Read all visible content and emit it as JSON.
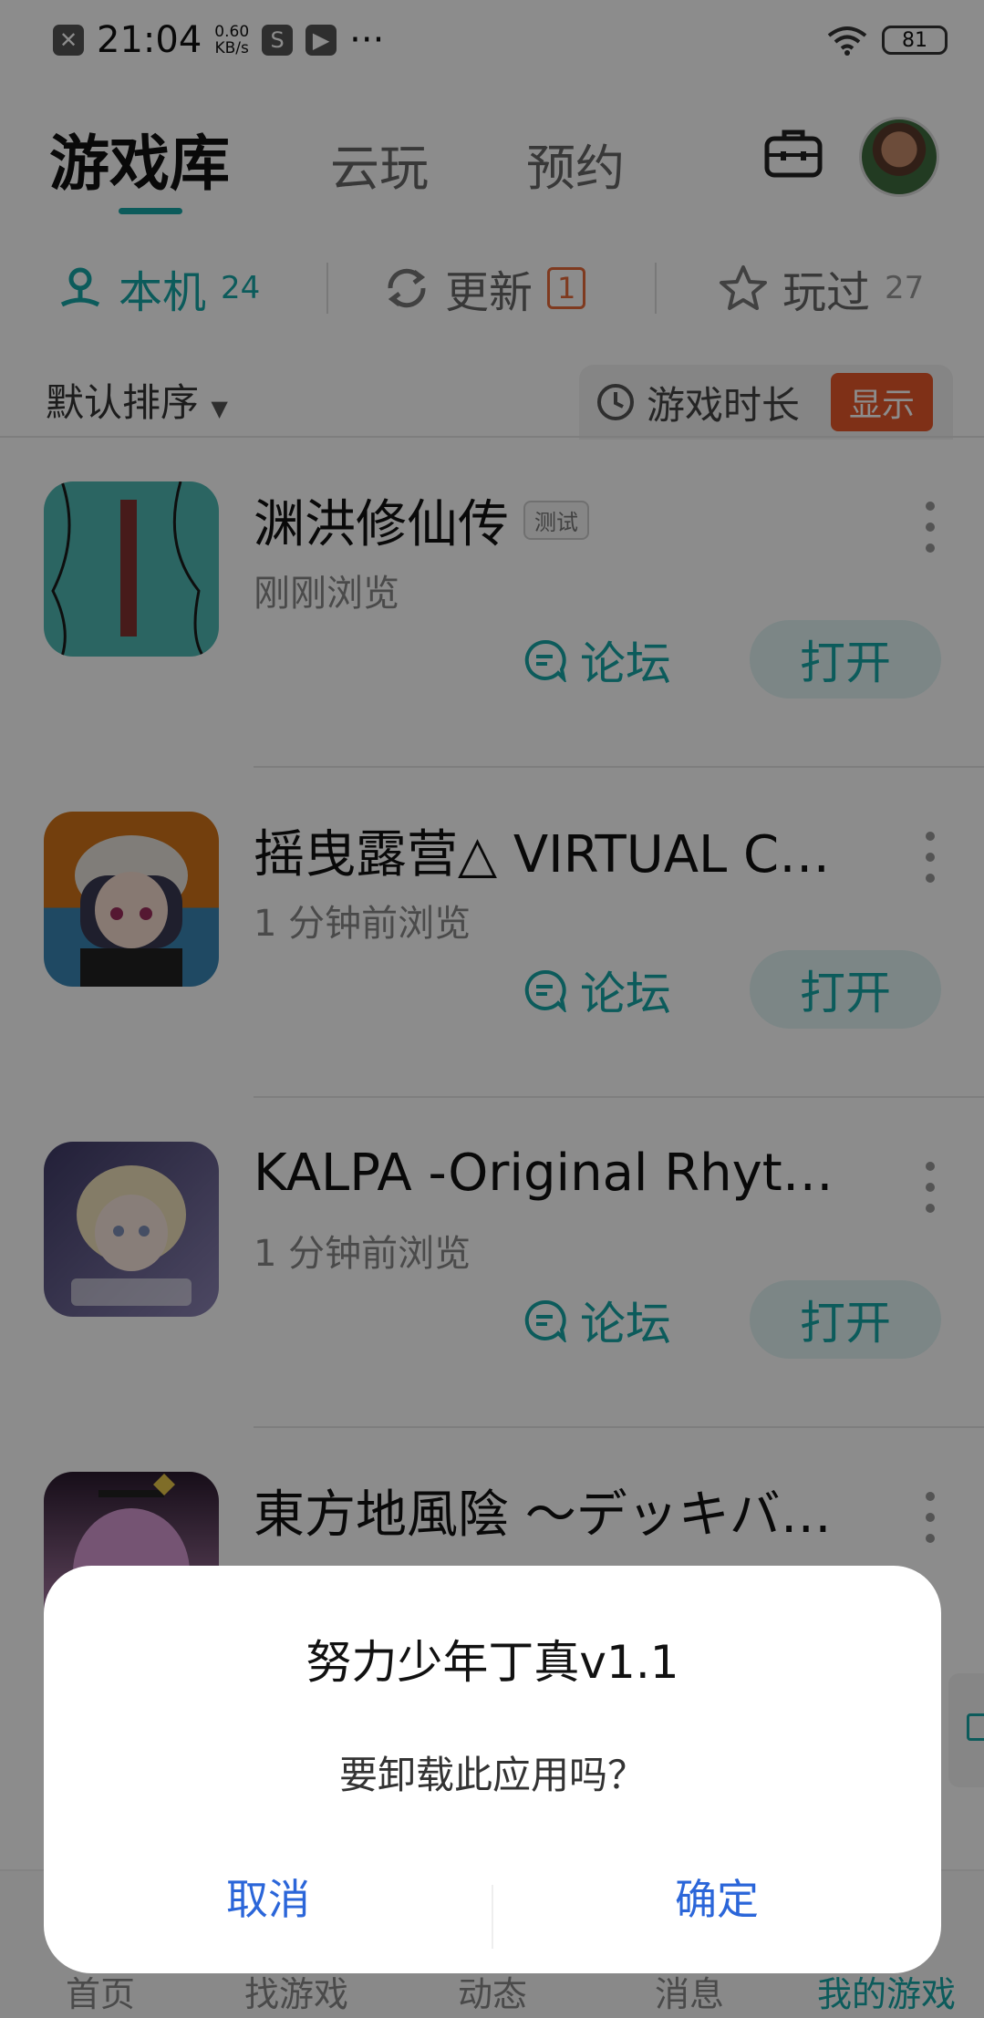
{
  "status_bar": {
    "time": "21:04",
    "speed_value": "0.60",
    "speed_unit": "KB/s",
    "more": "···",
    "battery": "81"
  },
  "top_tabs": {
    "library": "游戏库",
    "cloud": "云玩",
    "reserve": "预约"
  },
  "filters": {
    "local_label": "本机",
    "local_count": "24",
    "update_label": "更新",
    "update_count": "1",
    "played_label": "玩过",
    "played_count": "27"
  },
  "sort": {
    "label": "默认排序",
    "playtime_label": "游戏时长",
    "show_label": "显示"
  },
  "games": [
    {
      "title": "渊洪修仙传",
      "tag": "测试",
      "subtitle": "刚刚浏览",
      "forum": "论坛",
      "open": "打开"
    },
    {
      "title": "摇曳露营△ VIRTUAL C…",
      "tag": "",
      "subtitle": "1 分钟前浏览",
      "forum": "论坛",
      "open": "打开"
    },
    {
      "title": "KALPA -Original Rhyt…",
      "tag": "",
      "subtitle": "1 分钟前浏览",
      "forum": "论坛",
      "open": "打开"
    },
    {
      "title": "東方地風陰 〜デッキバ…",
      "tag": "",
      "subtitle": "",
      "forum": "",
      "open": ""
    }
  ],
  "bottom_nav": {
    "home": "首页",
    "find": "找游戏",
    "feed": "动态",
    "messages": "消息",
    "my_games": "我的游戏"
  },
  "dialog": {
    "title": "努力少年丁真v1.1",
    "message": "要卸载此应用吗？",
    "cancel": "取消",
    "confirm": "确定"
  },
  "colors": {
    "accent": "#16a6a6",
    "badge": "#e8582a",
    "dialog_button": "#2b66d9"
  }
}
